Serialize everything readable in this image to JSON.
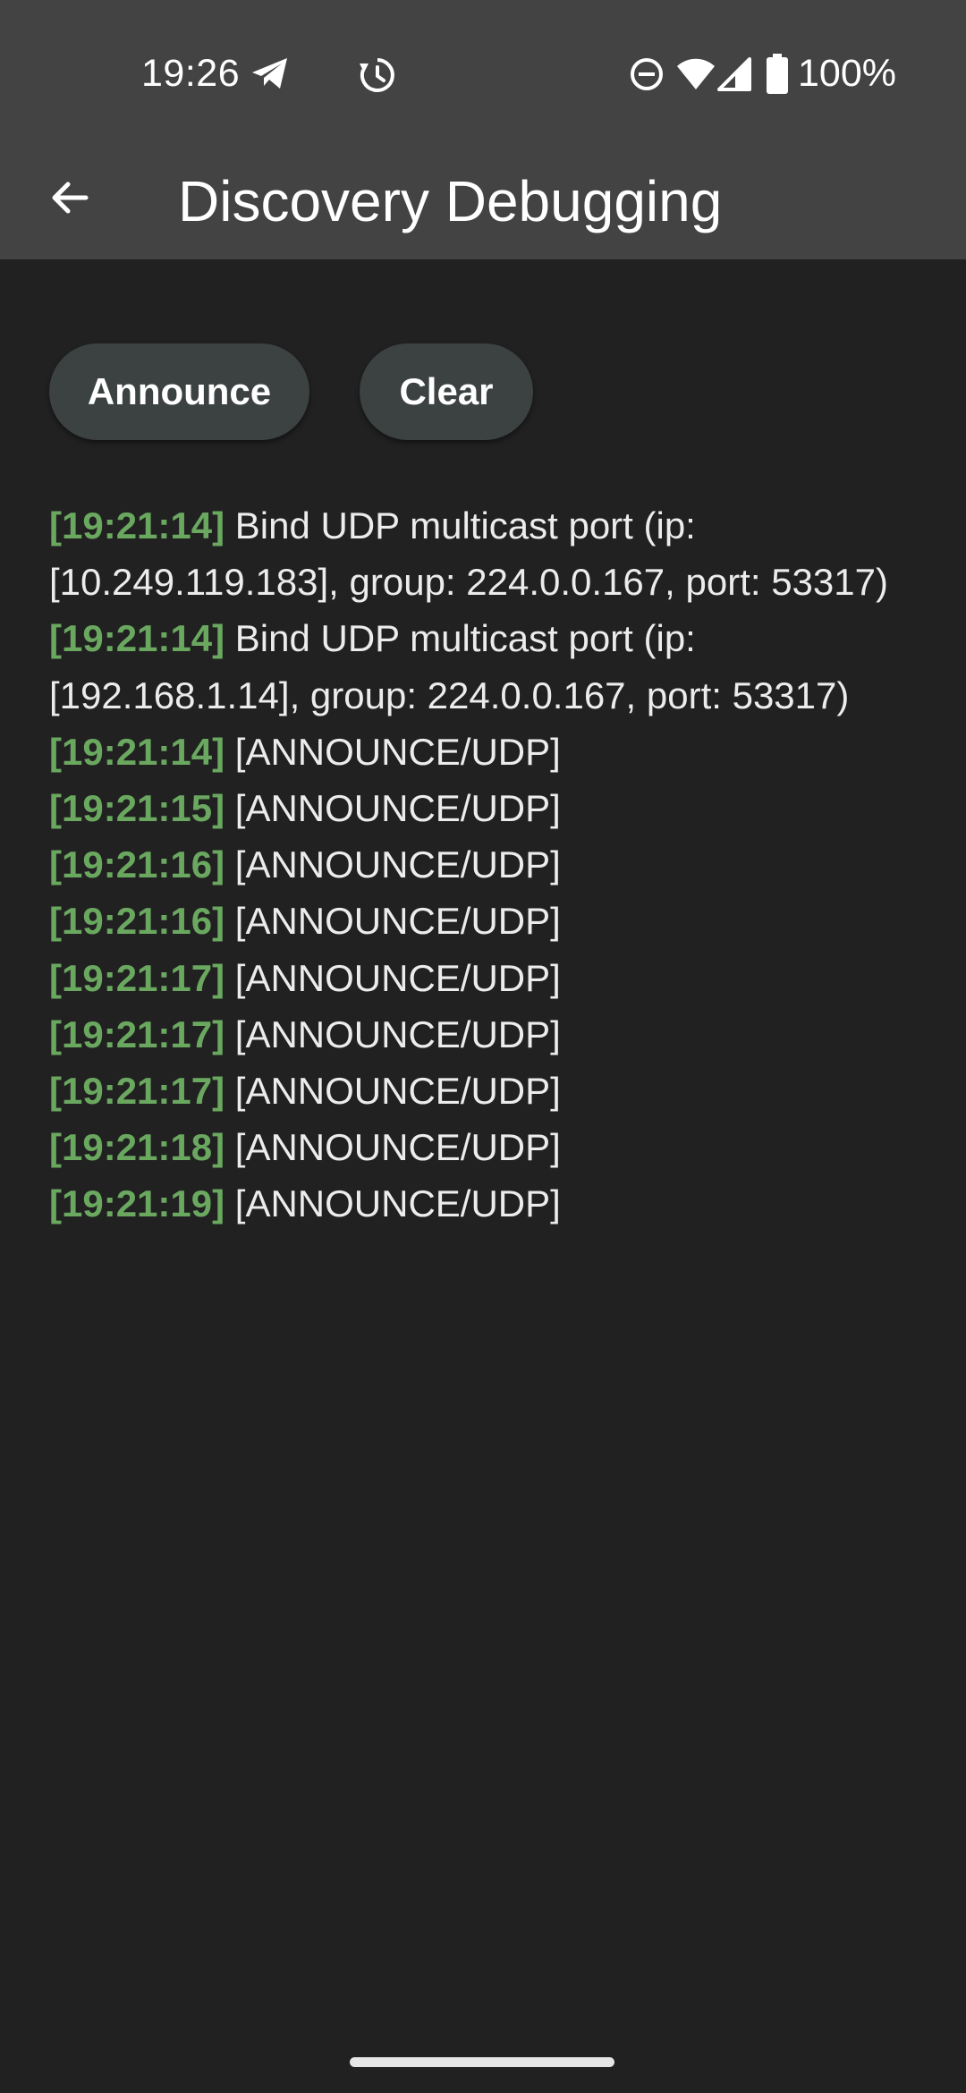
{
  "status_bar": {
    "time": "19:26",
    "battery": "100%",
    "icons": [
      "telegram-icon",
      "clock-sync-icon",
      "do-not-disturb-icon",
      "wifi-icon",
      "cell-signal-icon",
      "battery-icon"
    ]
  },
  "app_bar": {
    "title": "Discovery Debugging",
    "back_icon": "arrow-back-icon"
  },
  "actions": {
    "announce_label": "Announce",
    "clear_label": "Clear"
  },
  "log": [
    {
      "time": "[19:21:14]",
      "message": "Bind UDP multicast port (ip: [10.249.119.183], group: 224.0.0.167, port: 53317)"
    },
    {
      "time": "[19:21:14]",
      "message": "Bind UDP multicast port (ip: [192.168.1.14], group: 224.0.0.167, port: 53317)"
    },
    {
      "time": "[19:21:14]",
      "message": "[ANNOUNCE/UDP]"
    },
    {
      "time": "[19:21:15]",
      "message": "[ANNOUNCE/UDP]"
    },
    {
      "time": "[19:21:16]",
      "message": "[ANNOUNCE/UDP]"
    },
    {
      "time": "[19:21:16]",
      "message": "[ANNOUNCE/UDP]"
    },
    {
      "time": "[19:21:17]",
      "message": "[ANNOUNCE/UDP]"
    },
    {
      "time": "[19:21:17]",
      "message": "[ANNOUNCE/UDP]"
    },
    {
      "time": "[19:21:17]",
      "message": "[ANNOUNCE/UDP]"
    },
    {
      "time": "[19:21:18]",
      "message": "[ANNOUNCE/UDP]"
    },
    {
      "time": "[19:21:19]",
      "message": "[ANNOUNCE/UDP]"
    }
  ],
  "colors": {
    "timestamp": "#6aa860",
    "bar_background": "#434343",
    "page_background": "#212121",
    "button_background": "#3b4241"
  }
}
